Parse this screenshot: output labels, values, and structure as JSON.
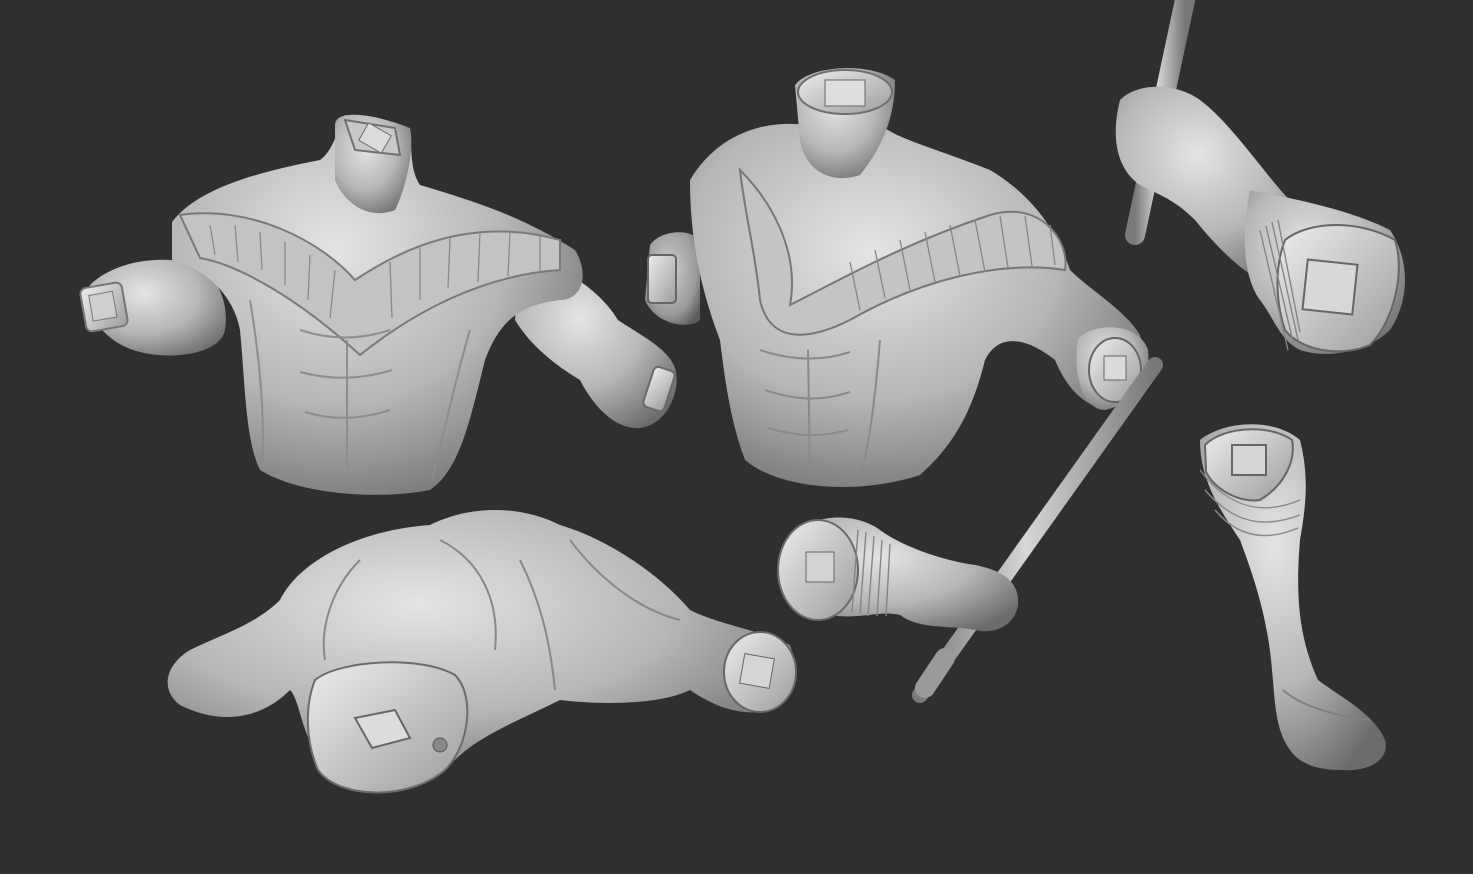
{
  "scene": {
    "background_color": "#2f2f2f",
    "clay_color": "#b9b9b9",
    "clay_shadow_color": "#6e6e6e",
    "clay_highlight_color": "#e6e6e6",
    "parts": [
      {
        "name": "torso-front-left"
      },
      {
        "name": "torso-front-center"
      },
      {
        "name": "torso-back"
      },
      {
        "name": "arm-with-staff-top"
      },
      {
        "name": "arm-with-staff-bottom"
      },
      {
        "name": "boot-leg"
      }
    ]
  }
}
